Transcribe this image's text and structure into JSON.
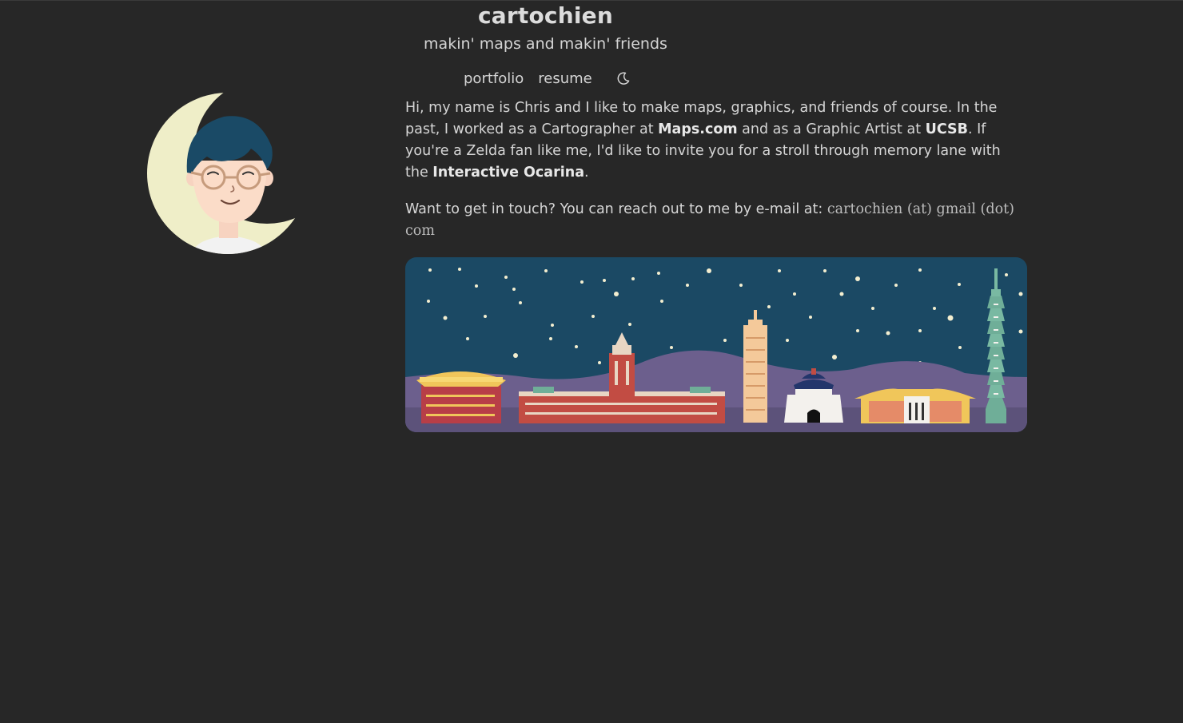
{
  "site": {
    "title": "cartochien",
    "tagline": "makin' maps and makin' friends"
  },
  "nav": {
    "items": [
      {
        "label": "portfolio"
      },
      {
        "label": "resume"
      }
    ],
    "theme_toggle_icon": "moon-icon"
  },
  "bio": {
    "part1": "Hi, my name is Chris and I like to make maps, graphics, and friends of course. In the past, I worked as a Cartographer at ",
    "maps_com": "Maps.com",
    "part2": " and as a Graphic Artist at ",
    "ucsb": "UCSB",
    "part3": ". If you're a Zelda fan like me, I'd like to invite you for a stroll through memory lane with the ",
    "ocarina": "Interactive Ocarina",
    "part4": "."
  },
  "contact": {
    "text": "Want to get in touch? You can reach out to me by e-mail at: ",
    "email": "cartochien (at) gmail (dot) com"
  },
  "colors": {
    "background": "#272727",
    "text": "#d6d6d6",
    "sky": "#1b4964",
    "hills": "#6c5f8d",
    "moon": "#efeec8"
  }
}
